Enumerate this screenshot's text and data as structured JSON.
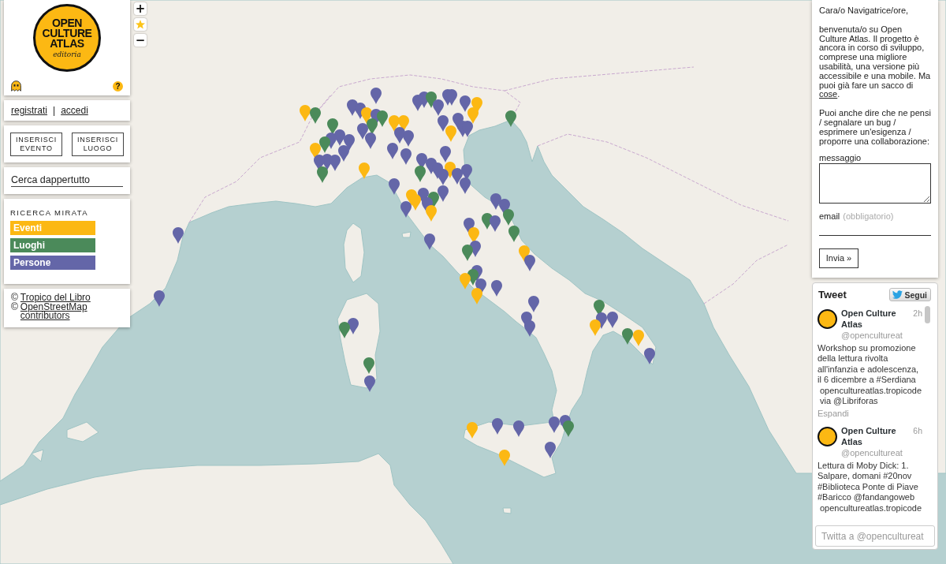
{
  "logo": {
    "title": "OPEN CULTURE ATLAS",
    "subtitle": "editoria"
  },
  "help": "?",
  "map_controls": {
    "zoom_in": "+",
    "zoom_out": "−"
  },
  "account": {
    "register": "registrati",
    "separator": "|",
    "login": "accedi"
  },
  "actions": [
    "INSERISCI EVENTO",
    "INSERISCI LUOGO"
  ],
  "search": {
    "placeholder": "Cerca dappertutto"
  },
  "filters": {
    "title": "RICERCA MIRATA",
    "items": [
      {
        "label": "Eventi",
        "color": "#fcb813"
      },
      {
        "label": "Luoghi",
        "color": "#4b8a5a"
      },
      {
        "label": "Persone",
        "color": "#6466a8"
      }
    ]
  },
  "credits": [
    {
      "prefix": "©",
      "link": "Tropico del Libro"
    },
    {
      "prefix": "©",
      "link": "OpenStreetMap contributors"
    }
  ],
  "welcome": {
    "greeting": "Cara/o Navigatrice/ore,",
    "intro": {
      "text": "benvenuta/o su Open Culture Atlas. Il progetto è ancora in corso di sviluppo, comprese una migliore usabilità, una versione più accessibile e una mobile. Ma puoi già fare un sacco di",
      "link": "cose",
      "end": "."
    },
    "feedback": "Puoi anche dire che ne pensi / segnalare un bug / esprimere un'esigenza / proporre una collaborazione:",
    "message_label": "messaggio",
    "email_label": "email",
    "email_hint": "(obbligatorio)",
    "submit": "Invia »"
  },
  "twitter": {
    "title": "Tweet",
    "follow": "Segui",
    "tweets": [
      {
        "name": "Open Culture Atlas",
        "time": "2h",
        "handle": "@opencultureat",
        "text": "Workshop su promozione della lettura rivolta all'infanzia e adolescenza, il 6 dicembre a #Serdiana",
        "link": "opencultureatlas.tropicode",
        "via": "via @Libriforas",
        "expand": "Espandi"
      },
      {
        "name": "Open Culture Atlas",
        "time": "6h",
        "handle": "@opencultureat",
        "text": "Lettura di Moby Dick: 1. Salpare, domani #20nov #Biblioteca Ponte di Piave #Baricco @fandangoweb",
        "link": "opencultureatlas.tropicode"
      }
    ],
    "compose": {
      "placeholder": "Twitta a @opencultureat"
    }
  }
}
